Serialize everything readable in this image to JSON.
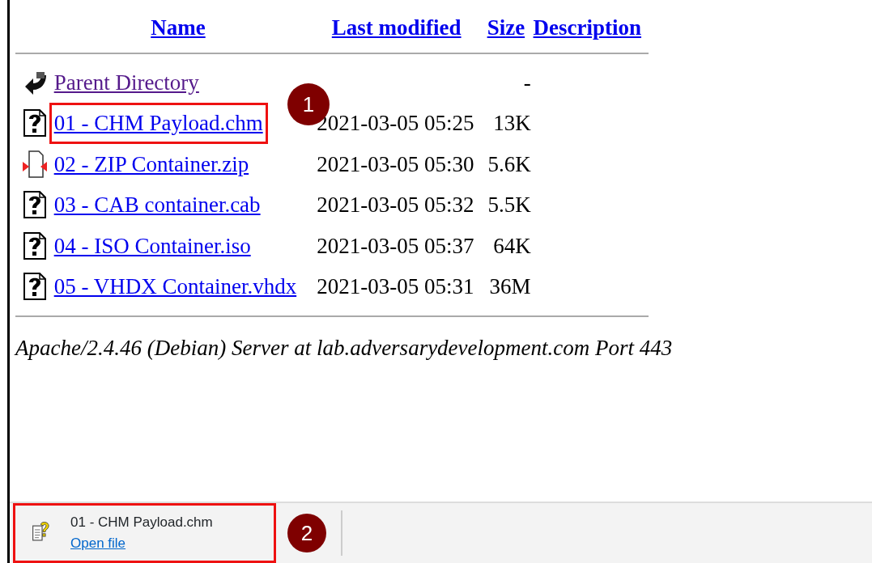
{
  "listing": {
    "columns": [
      {
        "label": "Name"
      },
      {
        "label": "Last modified"
      },
      {
        "label": "Size"
      },
      {
        "label": "Description"
      }
    ],
    "rows": [
      {
        "kind": "back",
        "name": "Parent Directory",
        "visited": true,
        "highlighted": false,
        "modified": "",
        "size": "-"
      },
      {
        "kind": "unknown",
        "name": "01 - CHM Payload.chm",
        "visited": false,
        "highlighted": true,
        "modified": "2021-03-05 05:25",
        "size": "13K"
      },
      {
        "kind": "compressed",
        "name": "02 - ZIP Container.zip",
        "visited": false,
        "highlighted": false,
        "modified": "2021-03-05 05:30",
        "size": "5.6K"
      },
      {
        "kind": "unknown",
        "name": "03 - CAB container.cab",
        "visited": false,
        "highlighted": false,
        "modified": "2021-03-05 05:32",
        "size": "5.5K"
      },
      {
        "kind": "unknown",
        "name": "04 - ISO Container.iso",
        "visited": false,
        "highlighted": false,
        "modified": "2021-03-05 05:37",
        "size": "64K"
      },
      {
        "kind": "unknown",
        "name": "05 - VHDX Container.vhdx",
        "visited": false,
        "highlighted": false,
        "modified": "2021-03-05 05:31",
        "size": "36M"
      }
    ],
    "callout": "1",
    "footer": "Apache/2.4.46 (Debian) Server at lab.adversarydevelopment.com Port 443"
  },
  "download_bar": {
    "item": {
      "filename": "01 - CHM Payload.chm",
      "action": "Open file",
      "highlighted": true
    },
    "callout": "2"
  }
}
